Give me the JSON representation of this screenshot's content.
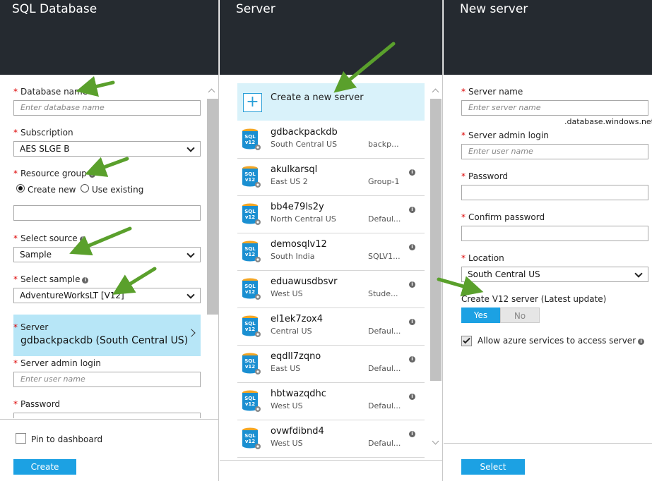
{
  "blades": {
    "sql": {
      "title": "SQL Database",
      "database_name": {
        "label": "Database name",
        "placeholder": "Enter database name"
      },
      "subscription": {
        "label": "Subscription",
        "value": "AES SLGE B"
      },
      "resource_group": {
        "label": "Resource group",
        "create_new": "Create new",
        "use_existing": "Use existing",
        "value": ""
      },
      "source": {
        "label": "Select source",
        "value": "Sample"
      },
      "sample": {
        "label": "Select sample",
        "value": "AdventureWorksLT [V12]"
      },
      "server": {
        "label": "Server",
        "value": "gdbackpackdb (South Central US)"
      },
      "admin_login": {
        "label": "Server admin login",
        "placeholder": "Enter user name"
      },
      "password": {
        "label": "Password"
      },
      "pin_label": "Pin to dashboard",
      "create_label": "Create"
    },
    "server": {
      "title": "Server",
      "create_new_label": "Create a new server",
      "items": [
        {
          "name": "gdbackpackdb",
          "location": "South Central US",
          "group": "backp..."
        },
        {
          "name": "akulkarsql",
          "location": "East US 2",
          "group": "Group-1"
        },
        {
          "name": "bb4e79ls2y",
          "location": "North Central US",
          "group": "Defaul..."
        },
        {
          "name": "demosqlv12",
          "location": "South India",
          "group": "SQLV1..."
        },
        {
          "name": "eduawusdbsvr",
          "location": "West US",
          "group": "Stude..."
        },
        {
          "name": "el1ek7zox4",
          "location": "Central US",
          "group": "Defaul..."
        },
        {
          "name": "eqdll7zqno",
          "location": "East US",
          "group": "Defaul..."
        },
        {
          "name": "hbtwazqdhc",
          "location": "West US",
          "group": "Defaul..."
        },
        {
          "name": "ovwfdibnd4",
          "location": "West US",
          "group": "Defaul..."
        }
      ]
    },
    "new_server": {
      "title": "New server",
      "server_name": {
        "label": "Server name",
        "placeholder": "Enter server name",
        "suffix": ".database.windows.net"
      },
      "admin_login": {
        "label": "Server admin login",
        "placeholder": "Enter user name"
      },
      "password": {
        "label": "Password"
      },
      "confirm_password": {
        "label": "Confirm password"
      },
      "location": {
        "label": "Location",
        "value": "South Central US"
      },
      "v12": {
        "label": "Create V12 server (Latest update)",
        "yes": "Yes",
        "no": "No"
      },
      "allow_azure": {
        "label": "Allow azure services to access server"
      },
      "select_label": "Select"
    }
  },
  "icons": {
    "info": "i",
    "db_icon": "SQL",
    "db_icon_ver": "v12"
  },
  "colors": {
    "header": "#252a30",
    "accent": "#1ca1e3",
    "selected": "#b7e6f7",
    "arrow": "#5aa02c"
  }
}
